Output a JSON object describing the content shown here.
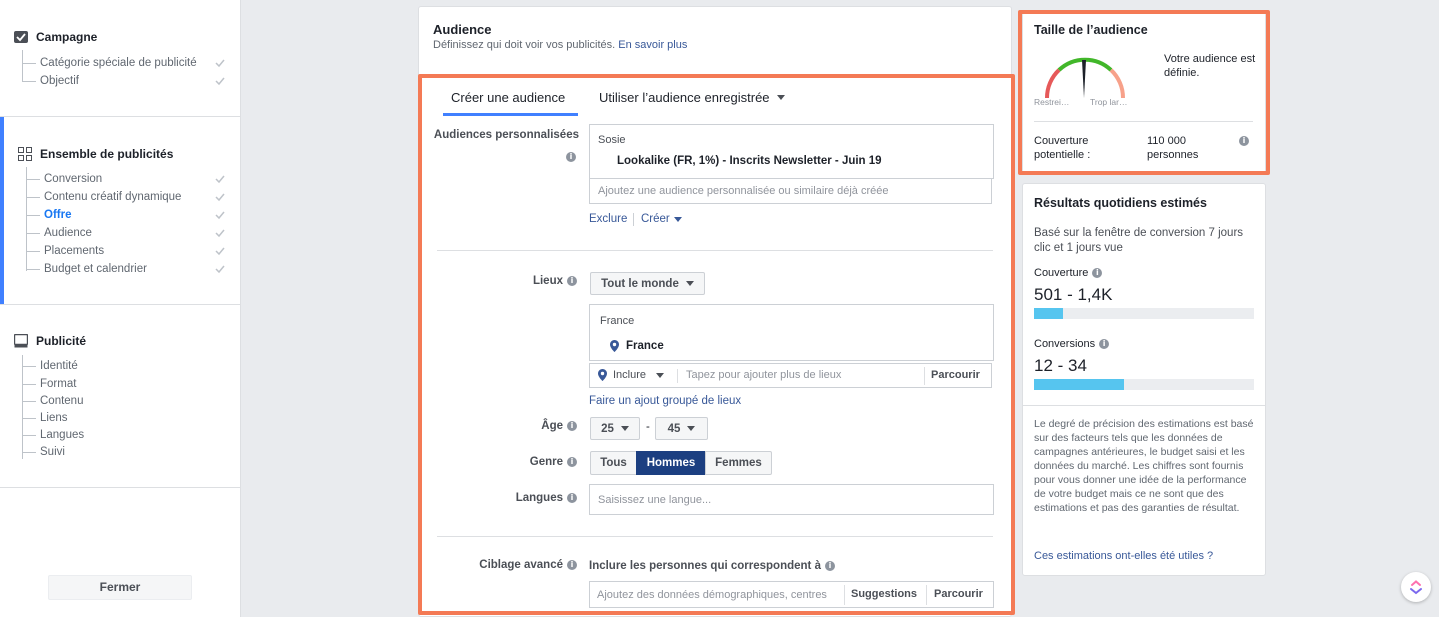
{
  "sidebar": {
    "campaign": {
      "title": "Campagne",
      "items": [
        "Catégorie spéciale de publicité",
        "Objectif"
      ]
    },
    "adset": {
      "title": "Ensemble de publicités",
      "items": [
        "Conversion",
        "Contenu créatif dynamique",
        "Offre",
        "Audience",
        "Placements",
        "Budget et calendrier"
      ]
    },
    "ad": {
      "title": "Publicité",
      "items": [
        "Identité",
        "Format",
        "Contenu",
        "Liens",
        "Langues",
        "Suivi"
      ]
    },
    "close_label": "Fermer"
  },
  "audience": {
    "title": "Audience",
    "subtitle": "Définissez qui doit voir vos publicités.",
    "learn_more": "En savoir plus",
    "tabs": [
      "Créer une audience",
      "Utiliser l’audience enregistrée"
    ],
    "custom_label": "Audiences personnalisées",
    "custom_group": "Sosie",
    "custom_selected": "Lookalike (FR, 1%) - Inscrits Newsletter - Juin 19",
    "custom_placeholder": "Ajoutez une audience personnalisée ou similaire déjà créée",
    "exclude": "Exclure",
    "create": "Créer",
    "locations_label": "Lieux",
    "locations_dropdown": "Tout le monde",
    "loc_group": "France",
    "loc_selected": "France",
    "include": "Inclure",
    "loc_placeholder": "Tapez pour ajouter plus de lieux",
    "browse": "Parcourir",
    "bulk": "Faire un ajout groupé de lieux",
    "age_label": "Âge",
    "age_min": "25",
    "age_sep": "-",
    "age_max": "45",
    "gender_label": "Genre",
    "genders": [
      "Tous",
      "Hommes",
      "Femmes"
    ],
    "languages_label": "Langues",
    "languages_placeholder": "Saisissez une langue...",
    "detailed_label": "Ciblage avancé",
    "detailed_include": "Inclure les personnes qui correspondent à",
    "detailed_placeholder": "Ajoutez des données démographiques, centres",
    "suggestions": "Suggestions",
    "browse2": "Parcourir"
  },
  "size": {
    "title": "Taille de l’audience",
    "status": "Votre audience est définie.",
    "left_label": "Restrei…",
    "right_label": "Trop lar…",
    "reach_label": "Couverture potentielle :",
    "reach_value": "110 000 personnes"
  },
  "results": {
    "title": "Résultats quotidiens estimés",
    "basis": "Basé sur la fenêtre de conversion 7 jours clic et 1 jours vue",
    "reach_label": "Couverture",
    "reach_value": "501 - 1,4K",
    "reach_fill": 0.13,
    "conv_label": "Conversions",
    "conv_value": "12 - 34",
    "conv_fill": 0.41,
    "disclaimer": "Le degré de précision des estimations est basé sur des facteurs tels que les données de campagnes antérieures, le budget saisi et les données du marché. Les chiffres sont fournis pour vous donner une idée de la performance de votre budget mais ce ne sont que des estimations et pas des garanties de résultat.",
    "feedback": "Ces estimations ont-elles été utiles ?"
  }
}
